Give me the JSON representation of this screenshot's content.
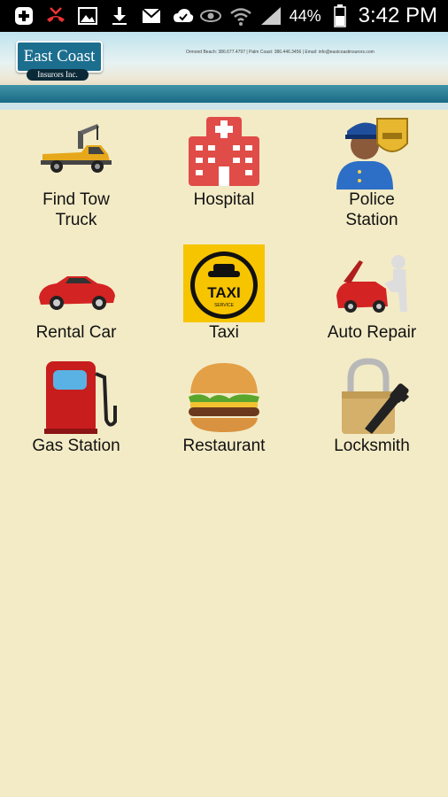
{
  "status_bar": {
    "icons": [
      "add-icon",
      "missed-call-icon",
      "image-icon",
      "download-icon",
      "mail-icon",
      "check-icon"
    ],
    "right_icons": [
      "eye-icon",
      "wifi-icon",
      "signal-icon",
      "battery-icon"
    ],
    "battery": "44%",
    "time": "3:42 PM"
  },
  "header": {
    "logo_text": "East Coast",
    "logo_subtext": "Insurors Inc.",
    "contact_text": "Ormond Beach: 386.677.4797 | Palm Coast: 386.446.3456 | Email: info@eastcoastinsurors.com"
  },
  "services": [
    {
      "label": "Find Tow Truck",
      "icon": "tow-truck-icon"
    },
    {
      "label": "Hospital",
      "icon": "hospital-icon"
    },
    {
      "label": "Police Station",
      "icon": "police-officer-icon"
    },
    {
      "label": "Rental Car",
      "icon": "rental-car-icon"
    },
    {
      "label": "Taxi",
      "icon": "taxi-icon"
    },
    {
      "label": "Auto Repair",
      "icon": "auto-repair-icon"
    },
    {
      "label": "Gas Station",
      "icon": "gas-pump-icon"
    },
    {
      "label": "Restaurant",
      "icon": "burger-icon"
    },
    {
      "label": "Locksmith",
      "icon": "padlock-key-icon"
    }
  ],
  "colors": {
    "background": "#f3ebc6",
    "header_band": "#1a6a84",
    "hospital_red": "#e04c48",
    "taxi_yellow": "#f7c400"
  }
}
